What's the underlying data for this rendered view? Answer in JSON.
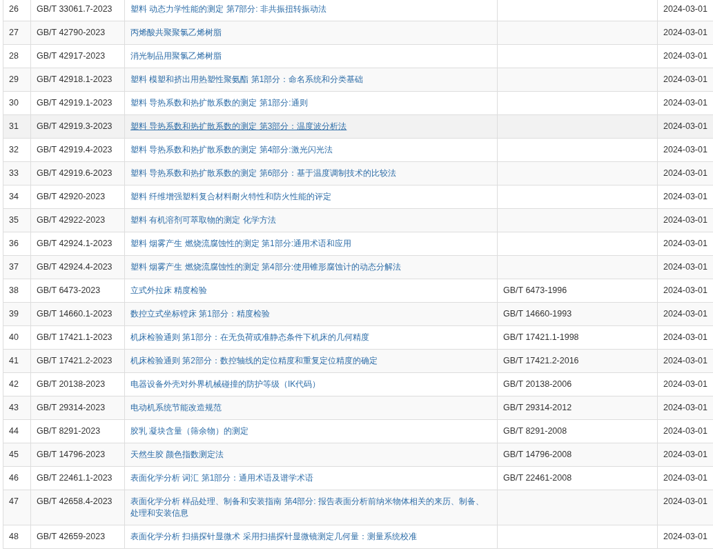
{
  "table": {
    "rows": [
      {
        "no": "26",
        "code": "GB/T 33061.7-2023",
        "title": "塑料 动态力学性能的测定 第7部分: 非共振扭转振动法",
        "replaces": "",
        "date": "2024-03-01",
        "hovered": false
      },
      {
        "no": "27",
        "code": "GB/T 42790-2023",
        "title": "丙烯酸共聚聚氯乙烯树脂",
        "replaces": "",
        "date": "2024-03-01",
        "hovered": false
      },
      {
        "no": "28",
        "code": "GB/T 42917-2023",
        "title": "消光制品用聚氯乙烯树脂",
        "replaces": "",
        "date": "2024-03-01",
        "hovered": false
      },
      {
        "no": "29",
        "code": "GB/T 42918.1-2023",
        "title": "塑料 模塑和挤出用热塑性聚氨酯 第1部分：命名系统和分类基础",
        "replaces": "",
        "date": "2024-03-01",
        "hovered": false
      },
      {
        "no": "30",
        "code": "GB/T 42919.1-2023",
        "title": "塑料 导热系数和热扩散系数的测定 第1部分:通则",
        "replaces": "",
        "date": "2024-03-01",
        "hovered": false
      },
      {
        "no": "31",
        "code": "GB/T 42919.3-2023",
        "title": "塑料 导热系数和热扩散系数的测定 第3部分：温度波分析法",
        "replaces": "",
        "date": "2024-03-01",
        "hovered": true
      },
      {
        "no": "32",
        "code": "GB/T 42919.4-2023",
        "title": "塑料 导热系数和热扩散系数的测定 第4部分:激光闪光法",
        "replaces": "",
        "date": "2024-03-01",
        "hovered": false
      },
      {
        "no": "33",
        "code": "GB/T 42919.6-2023",
        "title": "塑料 导热系数和热扩散系数的测定 第6部分：基于温度调制技术的比较法",
        "replaces": "",
        "date": "2024-03-01",
        "hovered": false
      },
      {
        "no": "34",
        "code": "GB/T 42920-2023",
        "title": "塑料 纤维增强塑料复合材料耐火特性和防火性能的评定",
        "replaces": "",
        "date": "2024-03-01",
        "hovered": false
      },
      {
        "no": "35",
        "code": "GB/T 42922-2023",
        "title": "塑料 有机溶剂可萃取物的测定 化学方法",
        "replaces": "",
        "date": "2024-03-01",
        "hovered": false
      },
      {
        "no": "36",
        "code": "GB/T 42924.1-2023",
        "title": "塑料 烟雾产生 燃烧流腐蚀性的测定 第1部分:通用术语和应用",
        "replaces": "",
        "date": "2024-03-01",
        "hovered": false
      },
      {
        "no": "37",
        "code": "GB/T 42924.4-2023",
        "title": "塑料 烟雾产生 燃烧流腐蚀性的测定 第4部分:使用锥形腐蚀计的动态分解法",
        "replaces": "",
        "date": "2024-03-01",
        "hovered": false
      },
      {
        "no": "38",
        "code": "GB/T 6473-2023",
        "title": "立式外拉床 精度检验",
        "replaces": "GB/T 6473-1996",
        "date": "2024-03-01",
        "hovered": false
      },
      {
        "no": "39",
        "code": "GB/T 14660.1-2023",
        "title": "数控立式坐标镗床 第1部分：精度检验",
        "replaces": "GB/T 14660-1993",
        "date": "2024-03-01",
        "hovered": false
      },
      {
        "no": "40",
        "code": "GB/T 17421.1-2023",
        "title": "机床检验通则 第1部分：在无负荷或准静态条件下机床的几何精度",
        "replaces": "GB/T 17421.1-1998",
        "date": "2024-03-01",
        "hovered": false
      },
      {
        "no": "41",
        "code": "GB/T 17421.2-2023",
        "title": "机床检验通则 第2部分：数控轴线的定位精度和重复定位精度的确定",
        "replaces": "GB/T 17421.2-2016",
        "date": "2024-03-01",
        "hovered": false
      },
      {
        "no": "42",
        "code": "GB/T 20138-2023",
        "title": "电器设备外壳对外界机械碰撞的防护等级（IK代码）",
        "replaces": "GB/T 20138-2006",
        "date": "2024-03-01",
        "hovered": false
      },
      {
        "no": "43",
        "code": "GB/T 29314-2023",
        "title": "电动机系统节能改造规范",
        "replaces": "GB/T 29314-2012",
        "date": "2024-03-01",
        "hovered": false
      },
      {
        "no": "44",
        "code": "GB/T 8291-2023",
        "title": "胶乳 凝块含量（筛余物）的测定",
        "replaces": "GB/T 8291-2008",
        "date": "2024-03-01",
        "hovered": false
      },
      {
        "no": "45",
        "code": "GB/T 14796-2023",
        "title": "天然生胶 颜色指数测定法",
        "replaces": "GB/T 14796-2008",
        "date": "2024-03-01",
        "hovered": false
      },
      {
        "no": "46",
        "code": "GB/T 22461.1-2023",
        "title": "表面化学分析 词汇 第1部分：通用术语及谱学术语",
        "replaces": "GB/T 22461-2008",
        "date": "2024-03-01",
        "hovered": false
      },
      {
        "no": "47",
        "code": "GB/T 42658.4-2023",
        "title": "表面化学分析 样品处理、制备和安装指南 第4部分: 报告表面分析前纳米物体相关的来历、制备、处理和安装信息",
        "replaces": "",
        "date": "2024-03-01",
        "hovered": false
      },
      {
        "no": "48",
        "code": "GB/T 42659-2023",
        "title": "表面化学分析 扫描探针显微术 采用扫描探针显微镜测定几何量：测量系统校准",
        "replaces": "",
        "date": "2024-03-01",
        "hovered": false
      }
    ]
  }
}
